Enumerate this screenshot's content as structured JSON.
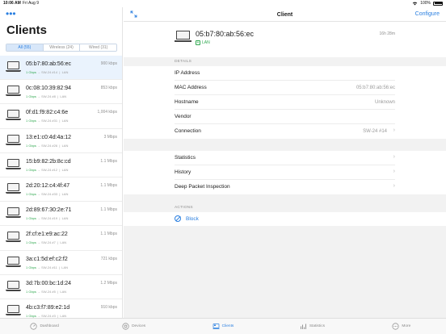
{
  "status_bar": {
    "time": "10:06 AM",
    "date": "Fri Aug 9",
    "battery": "100%"
  },
  "left": {
    "title": "Clients",
    "filters": [
      {
        "label": "All (55)",
        "active": true
      },
      {
        "label": "Wireless (24)",
        "active": false
      },
      {
        "label": "Wired (31)",
        "active": false
      }
    ],
    "clients": [
      {
        "mac": "05:b7:80:ab:56:ec",
        "rate": "900 kbps",
        "speed": "1 Gbps",
        "port": "SW-24 #14",
        "type": "LAN"
      },
      {
        "mac": "0c:08:10:39:82:94",
        "rate": "853 kbps",
        "speed": "1 Gbps",
        "port": "SW-24 #8",
        "type": "LAN"
      },
      {
        "mac": "0f:d1:f9:82:c4:6e",
        "rate": "1,004 kbps",
        "speed": "1 Gbps",
        "port": "SW-24 #31",
        "type": "LAN"
      },
      {
        "mac": "13:e1:c0:4d:4a:12",
        "rate": "3 Mbps",
        "speed": "1 Gbps",
        "port": "SW-24 #26",
        "type": "LAN"
      },
      {
        "mac": "15:b9:82:2b:8c:cd",
        "rate": "1.1 Mbps",
        "speed": "1 Gbps",
        "port": "SW-24 #12",
        "type": "LAN"
      },
      {
        "mac": "2d:20:12:c4:4f:47",
        "rate": "1.1 Mbps",
        "speed": "1 Gbps",
        "port": "SW-24 #33",
        "type": "LAN"
      },
      {
        "mac": "2d:89:67:30:2e:71",
        "rate": "1.1 Mbps",
        "speed": "1 Gbps",
        "port": "SW-24 #19",
        "type": "LAN"
      },
      {
        "mac": "2f:cf:e1:e9:ac:22",
        "rate": "1.1 Mbps",
        "speed": "1 Gbps",
        "port": "SW-24 #7",
        "type": "LAN"
      },
      {
        "mac": "3a:c1:5d:ef:c2:f2",
        "rate": "721 kbps",
        "speed": "1 Gbps",
        "port": "SW-24 #11",
        "type": "LAN"
      },
      {
        "mac": "3d:7b:00:bc:1d:24",
        "rate": "1.2 Mbps",
        "speed": "1 Gbps",
        "port": "SW-24 #5",
        "type": "LAN"
      },
      {
        "mac": "4b:c3:f7:89:e2:1d",
        "rate": "910 kbps",
        "speed": "1 Gbps",
        "port": "SW-24 #3",
        "type": "LAN"
      }
    ]
  },
  "detail": {
    "nav_title": "Client",
    "configure_label": "Configure",
    "mac": "05:b7:80:ab:56:ec",
    "uptime": "16h 28m",
    "connection_type": "LAN",
    "details_header": "DETAILS",
    "details": [
      {
        "label": "IP Address",
        "value": ""
      },
      {
        "label": "MAC Address",
        "value": "05:b7:80:ab:56:ec"
      },
      {
        "label": "Hostname",
        "value": "Unknown"
      },
      {
        "label": "Vendor",
        "value": ""
      },
      {
        "label": "Connection",
        "value": "SW-24 #14"
      }
    ],
    "links": [
      {
        "label": "Statistics"
      },
      {
        "label": "History"
      },
      {
        "label": "Deep Packet Inspection"
      }
    ],
    "actions_header": "ACTIONS",
    "block_label": "Block"
  },
  "tabbar": [
    {
      "label": "Dashboard",
      "icon": "dashboard-icon",
      "active": false
    },
    {
      "label": "Devices",
      "icon": "devices-icon",
      "active": false
    },
    {
      "label": "Clients",
      "icon": "clients-icon",
      "active": true
    },
    {
      "label": "Statistics",
      "icon": "statistics-icon",
      "active": false
    },
    {
      "label": "More",
      "icon": "more-icon",
      "active": false
    }
  ],
  "colors": {
    "accent": "#2a7fe0",
    "online": "#2fa84f"
  }
}
